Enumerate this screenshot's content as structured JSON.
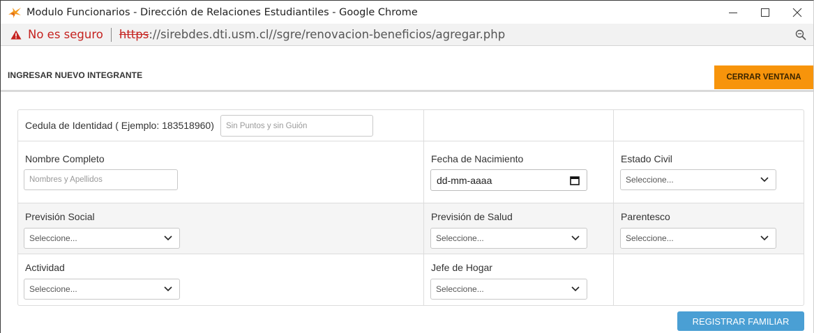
{
  "window": {
    "title": "Modulo Funcionarios - Dirección de Relaciones Estudiantiles - Google Chrome",
    "minimize_icon": "minimize-icon",
    "maximize_icon": "maximize-icon",
    "close_icon": "close-icon"
  },
  "addressbar": {
    "security_text": "No es seguro",
    "url_scheme": "https",
    "url_rest": "://sirebdes.dti.usm.cl//sgre/renovacion-beneficios/agregar.php",
    "warning_icon": "warning-triangle-icon",
    "zoom_icon": "zoom-icon"
  },
  "header": {
    "title": "INGRESAR NUEVO INTEGRANTE",
    "close_label": "CERRAR VENTANA",
    "accent_color": "#f7940b"
  },
  "form": {
    "rut_label": "Cedula de Identidad ( Ejemplo: 183518960)",
    "rut_placeholder": "Sin Puntos y sin Guión",
    "name_label": "Nombre Completo",
    "name_placeholder": "Nombres y Apellidos",
    "birth_label": "Fecha de Nacimiento",
    "birth_value": "dd-mm-aaaa",
    "civil_label": "Estado Civil",
    "civil_value": "Seleccione...",
    "social_label": "Previsión Social",
    "social_value": "Seleccione...",
    "health_label": "Previsión de Salud",
    "health_value": "Seleccione...",
    "relation_label": "Parentesco",
    "relation_value": "Seleccione...",
    "activity_label": "Actividad",
    "activity_value": "Seleccione...",
    "head_label": "Jefe de Hogar",
    "head_value": "Seleccione..."
  },
  "actions": {
    "register_label": "REGISTRAR FAMILIAR",
    "register_color": "#4a9fd4"
  }
}
